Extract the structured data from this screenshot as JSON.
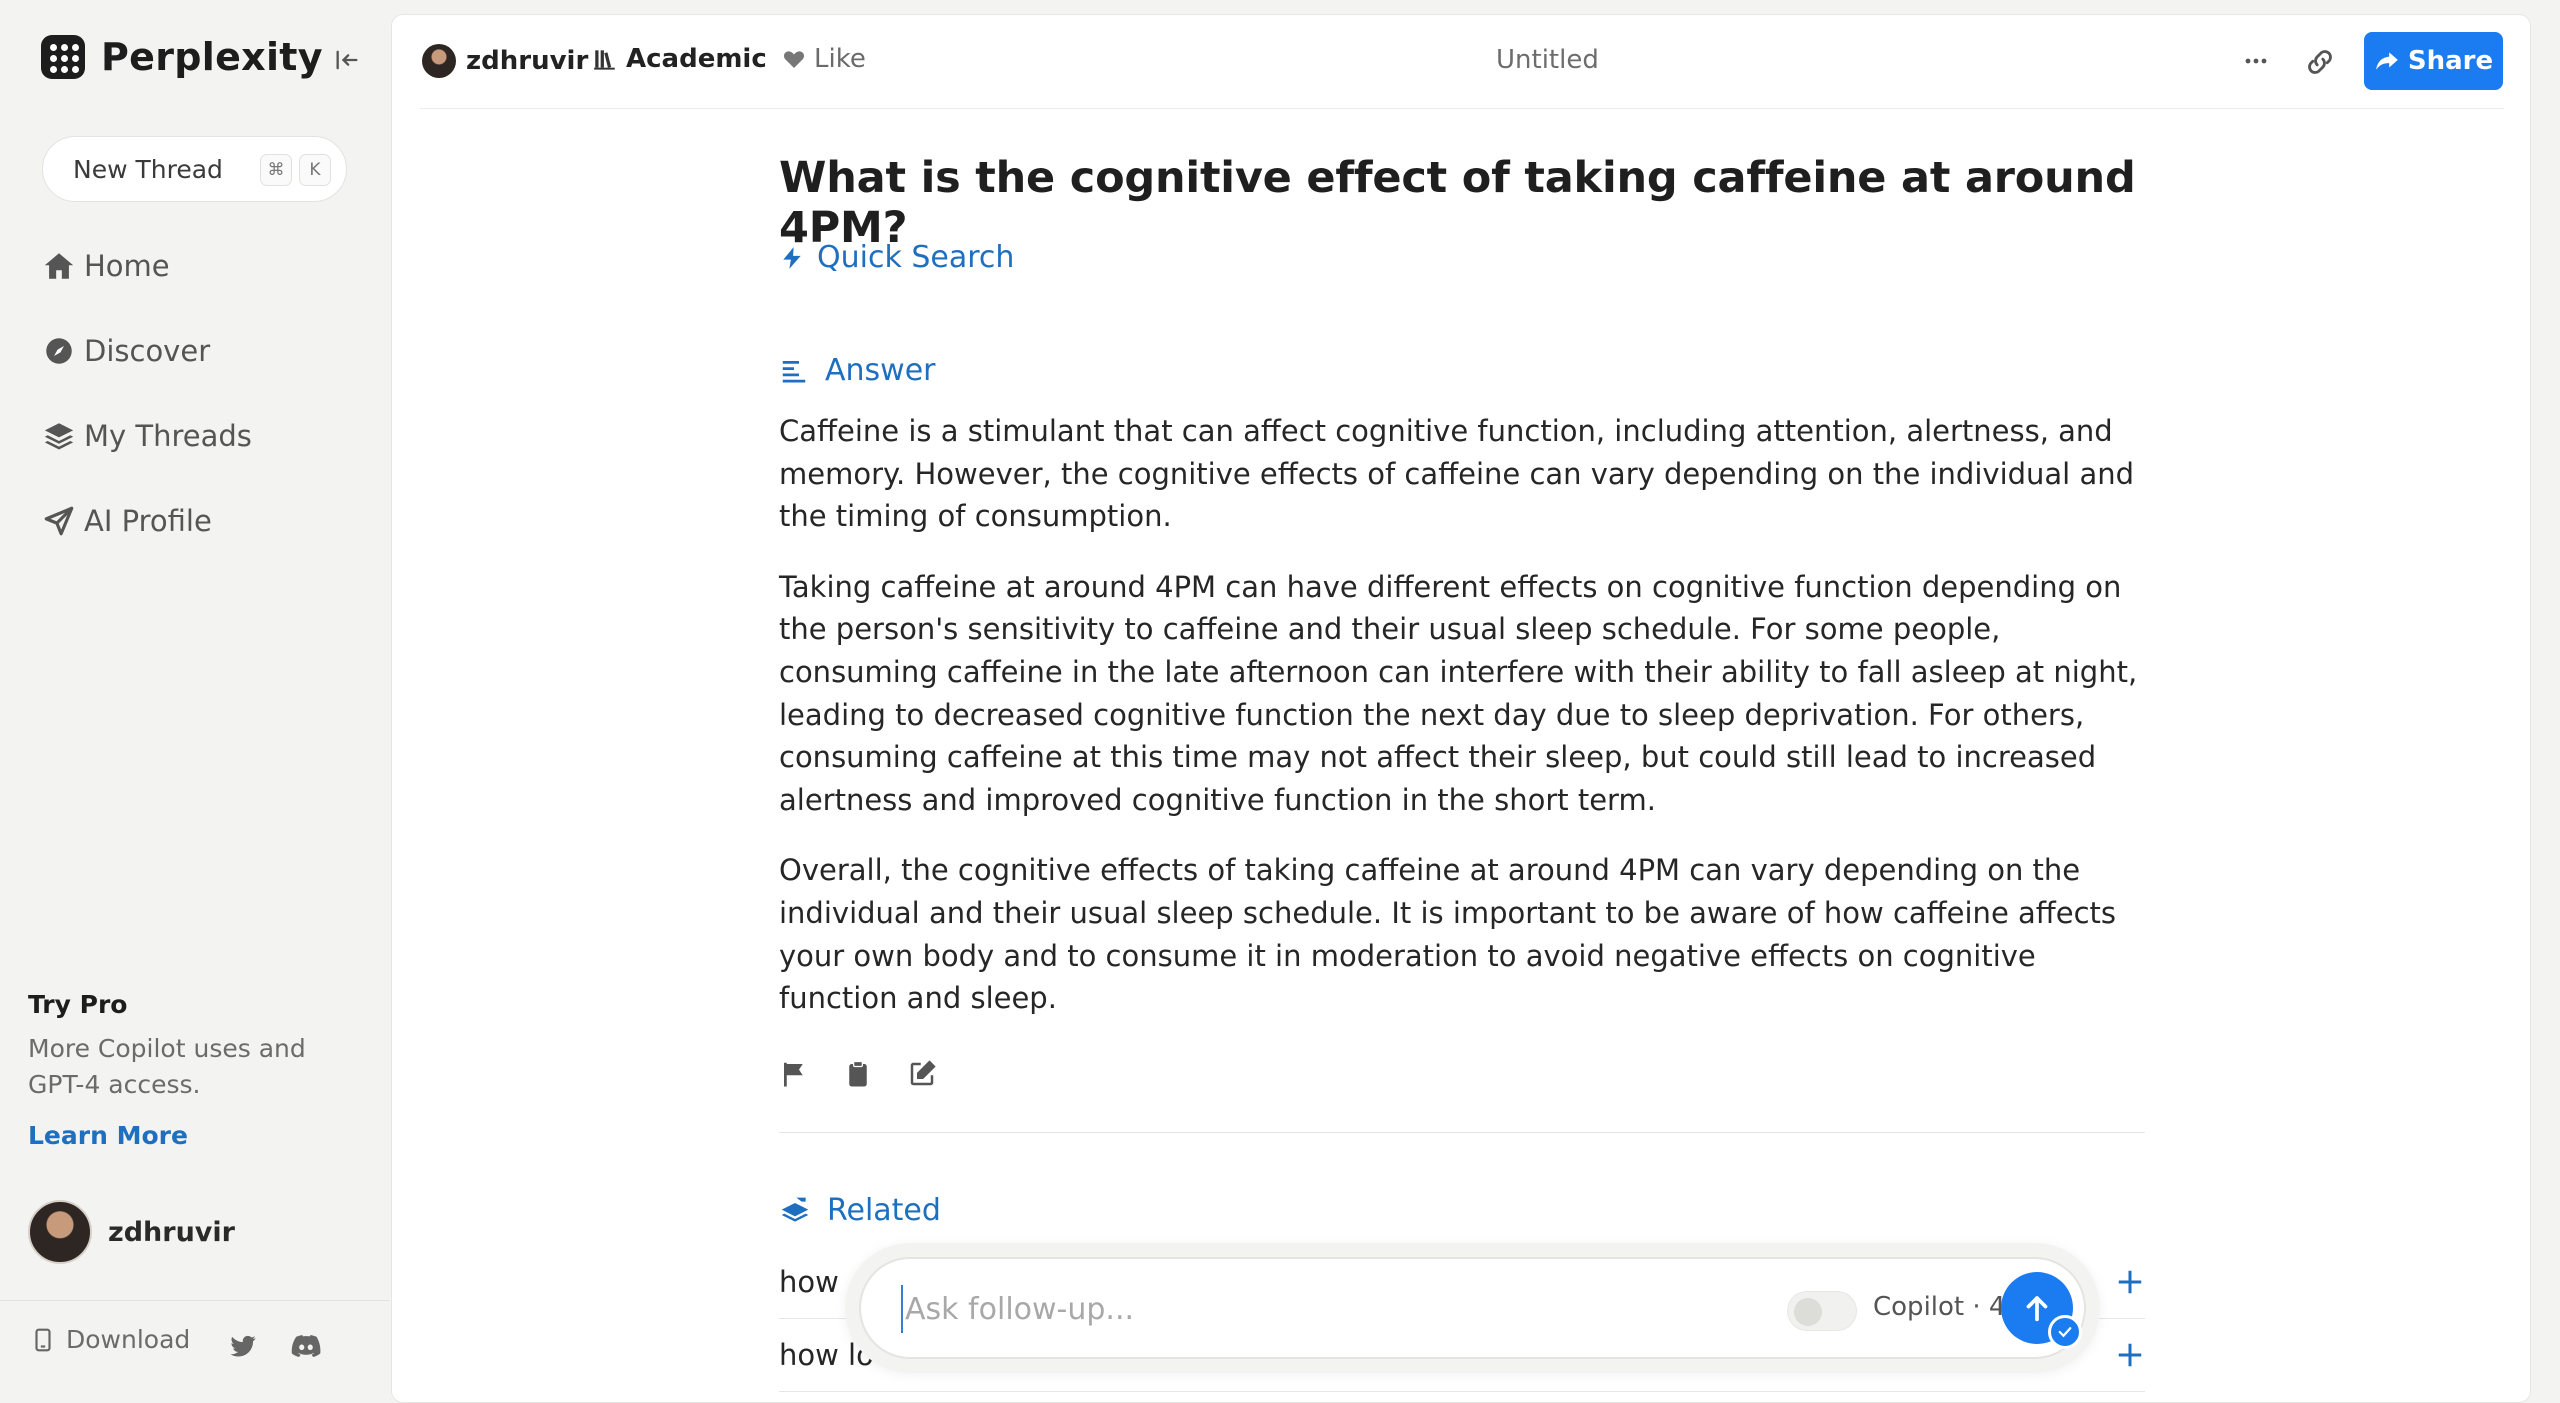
{
  "app": {
    "name": "Perplexity"
  },
  "sidebar": {
    "new_thread": {
      "label": "New Thread",
      "shortcut_cmd": "⌘",
      "shortcut_key": "K"
    },
    "nav": [
      {
        "label": "Home",
        "icon": "home-icon"
      },
      {
        "label": "Discover",
        "icon": "compass-icon"
      },
      {
        "label": "My Threads",
        "icon": "layers-icon"
      },
      {
        "label": "AI Profile",
        "icon": "send-icon"
      }
    ],
    "try_pro": {
      "title": "Try Pro",
      "description": "More Copilot uses and GPT-4 access.",
      "link": "Learn More"
    },
    "user": {
      "name": "zdhruvir"
    },
    "footer": {
      "download": "Download"
    }
  },
  "topbar": {
    "user": "zdhruvir",
    "focus": "Academic",
    "like": "Like",
    "title": "Untitled",
    "share": "Share"
  },
  "thread": {
    "question": "What is the cognitive effect of taking caffeine at around 4PM?",
    "mode": "Quick Search",
    "answer_heading": "Answer",
    "answer_paragraphs": [
      "Caffeine is a stimulant that can affect cognitive function, including attention, alertness, and memory. However, the cognitive effects of caffeine can vary depending on the individual and the timing of consumption.",
      "Taking caffeine at around 4PM can have different effects on cognitive function depending on the person's sensitivity to caffeine and their usual sleep schedule. For some people, consuming caffeine in the late afternoon can interfere with their ability to fall asleep at night, leading to decreased cognitive function the next day due to sleep deprivation. For others, consuming caffeine at this time may not affect their sleep, but could still lead to increased alertness and improved cognitive function in the short term.",
      "Overall, the cognitive effects of taking caffeine at around 4PM can vary depending on the individual and their usual sleep schedule. It is important to be aware of how caffeine affects your own body and to consume it in moderation to avoid negative effects on cognitive function and sleep."
    ],
    "related_heading": "Related",
    "related": [
      "how",
      "how lo"
    ]
  },
  "followup": {
    "placeholder": "Ask follow-up...",
    "value": "",
    "copilot_label": "Copilot · 4",
    "copilot_enabled": false
  },
  "colors": {
    "accent": "#1a7cf0",
    "link": "#1f6fc0"
  }
}
